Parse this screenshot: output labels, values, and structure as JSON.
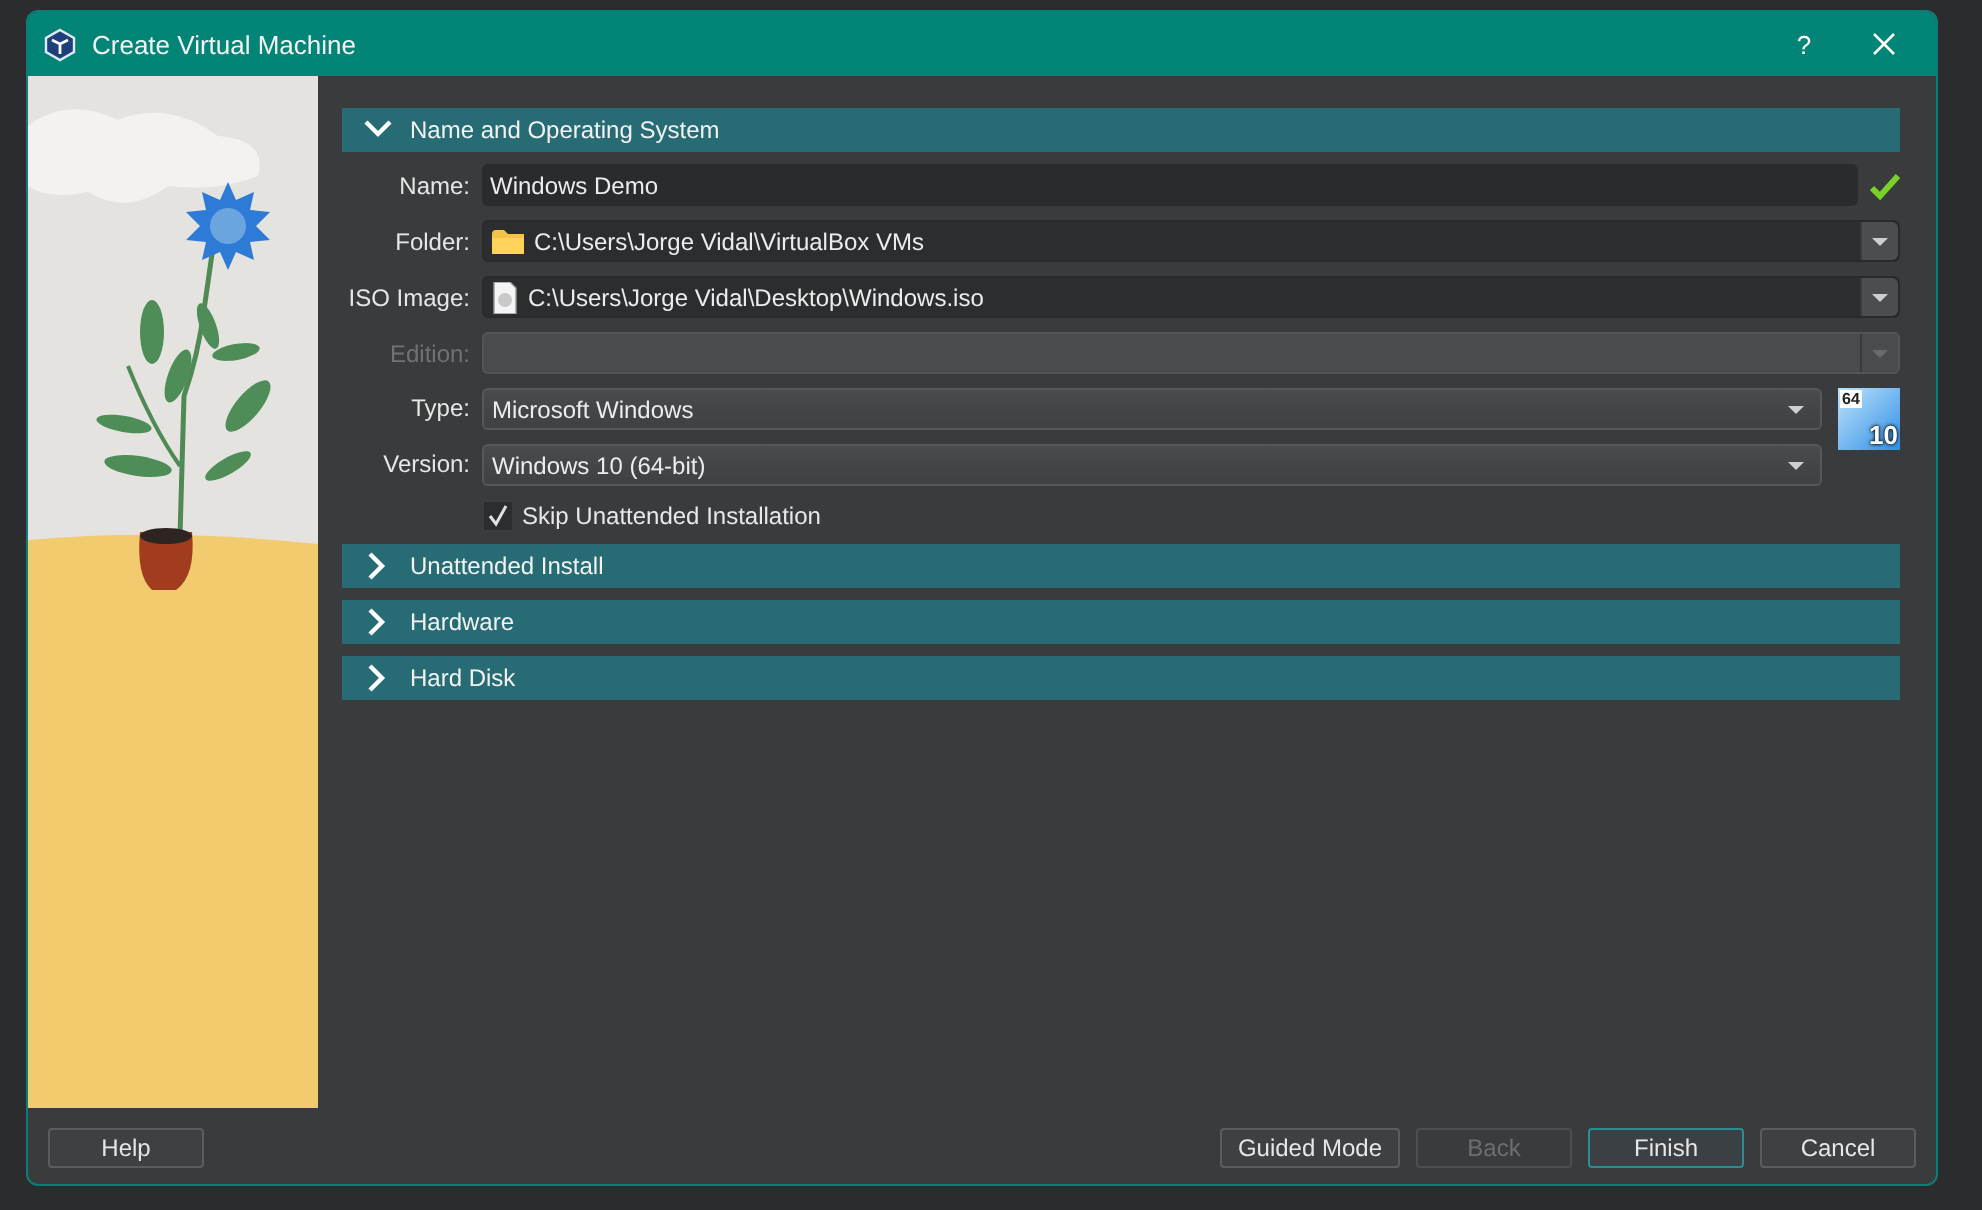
{
  "window": {
    "title": "Create Virtual Machine",
    "help": "?"
  },
  "sections": [
    {
      "title": "Name and Operating System",
      "expanded": true,
      "fields": [
        {
          "kind": "text",
          "label": "Name:",
          "value": "Windows Demo",
          "valid": true,
          "disabled": false
        },
        {
          "kind": "folder",
          "label": "Folder:",
          "value": "C:\\Users\\Jorge Vidal\\VirtualBox VMs",
          "disabled": false
        },
        {
          "kind": "file",
          "label": "ISO Image:",
          "value": "C:\\Users\\Jorge Vidal\\Desktop\\Windows.iso",
          "disabled": false
        },
        {
          "kind": "combo",
          "label": "Edition:",
          "disabled": true
        },
        {
          "kind": "select",
          "label": "Type:",
          "value": "Microsoft Windows",
          "disabled": false
        },
        {
          "kind": "select",
          "label": "Version:",
          "value": "Windows 10 (64-bit)",
          "disabled": false
        },
        {
          "kind": "checkbox",
          "label": "Skip Unattended Installation",
          "checked": true,
          "disabled": false
        }
      ],
      "os_badge": {
        "bits": "64",
        "version": "10"
      }
    },
    {
      "title": "Unattended Install",
      "expanded": false
    },
    {
      "title": "Hardware",
      "expanded": false
    },
    {
      "title": "Hard Disk",
      "expanded": false
    }
  ],
  "footer": {
    "left": [
      {
        "label": "Help",
        "disabled": false,
        "default": false
      }
    ],
    "right": [
      {
        "label": "Guided Mode",
        "disabled": false,
        "default": false
      },
      {
        "label": "Back",
        "disabled": true,
        "default": false
      },
      {
        "label": "Finish",
        "disabled": false,
        "default": true
      },
      {
        "label": "Cancel",
        "disabled": false,
        "default": false
      }
    ]
  }
}
